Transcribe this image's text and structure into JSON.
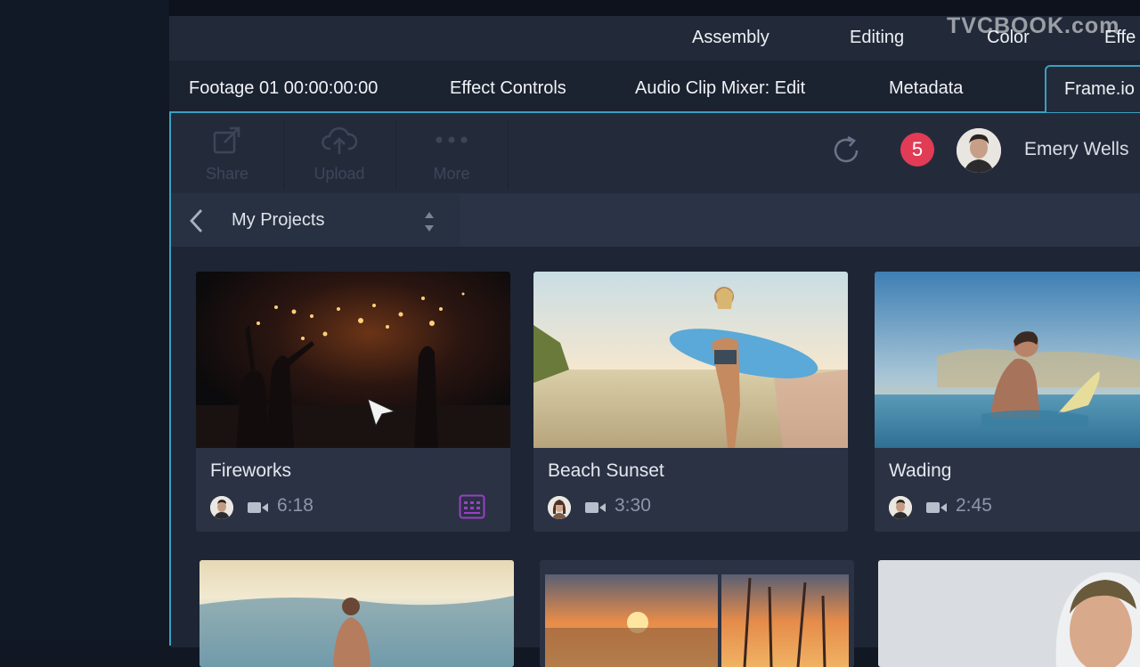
{
  "watermark": "TVCBOOK.com",
  "workspaces": [
    "Assembly",
    "Editing",
    "Color",
    "Effe"
  ],
  "panel_tabs": {
    "footage": "Footage 01  00:00:00:00",
    "effect_controls": "Effect Controls",
    "audio_mixer": "Audio Clip Mixer: Edit",
    "metadata": "Metadata",
    "frameio": "Frame.io"
  },
  "toolbar": {
    "share": "Share",
    "upload": "Upload",
    "more": "More",
    "notifications": "5",
    "user_name": "Emery Wells"
  },
  "nav": {
    "title": "My Projects"
  },
  "videos": [
    {
      "title": "Fireworks",
      "duration": "6:18",
      "has_comments": true
    },
    {
      "title": "Beach Sunset",
      "duration": "3:30",
      "has_comments": false
    },
    {
      "title": "Wading",
      "duration": "2:45",
      "has_comments": false
    }
  ],
  "colors": {
    "accent": "#3aa0c0",
    "badge": "#e23b55",
    "comment_icon": "#9b3fc7"
  }
}
